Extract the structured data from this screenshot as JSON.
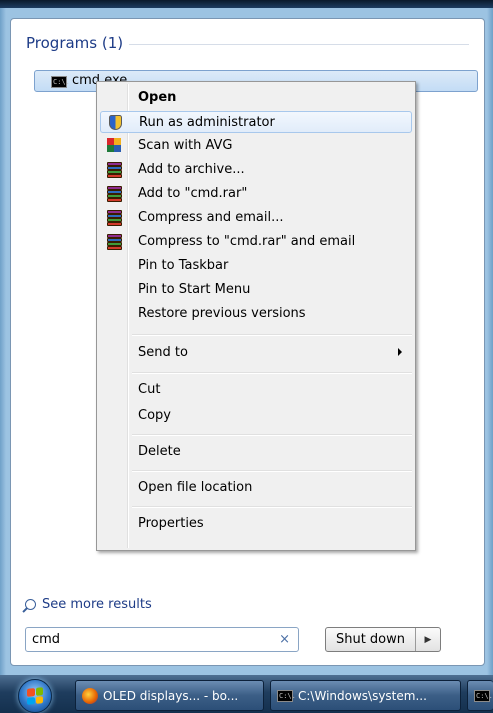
{
  "start_menu": {
    "programs_header": "Programs (1)",
    "result_label": "cmd.exe",
    "cmd_icon_text": "C:\\.",
    "see_more": "See more results",
    "search_value": "cmd",
    "clear_glyph": "×",
    "shutdown_label": "Shut down",
    "shutdown_arrow": "▶"
  },
  "context_menu": {
    "items": [
      {
        "label": "Open",
        "icon": "none"
      },
      {
        "label": "Run as administrator",
        "icon": "uac-shield-icon"
      },
      {
        "label": "Scan with AVG",
        "icon": "avg-icon"
      },
      {
        "label": "Add to archive...",
        "icon": "winrar-icon"
      },
      {
        "label": "Add to \"cmd.rar\"",
        "icon": "winrar-icon"
      },
      {
        "label": "Compress and email...",
        "icon": "winrar-icon"
      },
      {
        "label": "Compress to \"cmd.rar\" and email",
        "icon": "winrar-icon"
      },
      {
        "label": "Pin to Taskbar",
        "icon": "none"
      },
      {
        "label": "Pin to Start Menu",
        "icon": "none"
      },
      {
        "label": "Restore previous versions",
        "icon": "none"
      },
      {
        "label": "Send to",
        "icon": "none"
      },
      {
        "label": "Cut",
        "icon": "none"
      },
      {
        "label": "Copy",
        "icon": "none"
      },
      {
        "label": "Delete",
        "icon": "none"
      },
      {
        "label": "Open file location",
        "icon": "none"
      },
      {
        "label": "Properties",
        "icon": "none"
      }
    ]
  },
  "taskbar": {
    "firefox_task": "OLED displays... - bo...",
    "cmd_task": "C:\\Windows\\system..."
  },
  "colors": {
    "highlight": "#e1ecfa",
    "header_blue": "#1e3c87",
    "menu_bg": "#f0f0f0"
  }
}
